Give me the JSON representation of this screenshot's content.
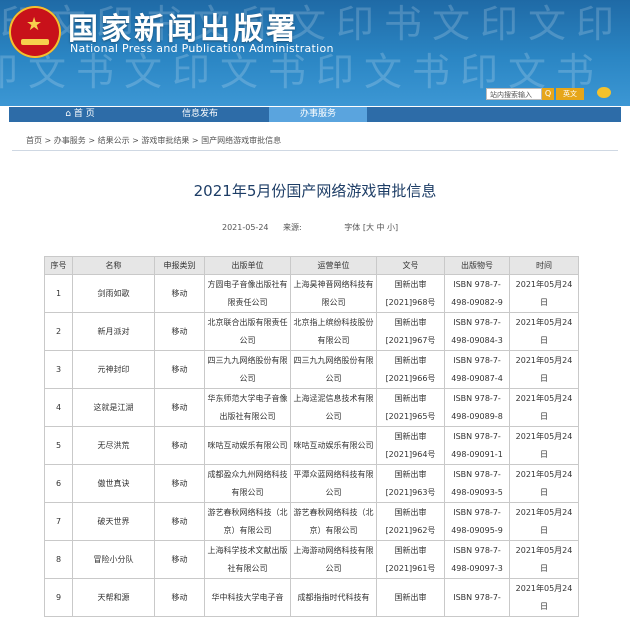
{
  "site": {
    "title": "国家新闻出版署",
    "subtitle": "National Press and Publication Administration",
    "search_placeholder": "站内搜索输入",
    "search_button": "Q",
    "lang_label": "英文"
  },
  "nav": [
    {
      "label": "首  页",
      "active": false
    },
    {
      "label": "信息发布",
      "active": false
    },
    {
      "label": "办事服务",
      "active": true
    }
  ],
  "breadcrumb": "首页 > 办事服务 > 结果公示 > 游戏审批结果 > 国产网络游戏审批信息",
  "article": {
    "title": "2021年5月份国产网络游戏审批信息",
    "date": "2021-05-24",
    "source_label": "来源:",
    "font_label": "字体 [大 中 小]"
  },
  "table": {
    "headers": [
      "序号",
      "名称",
      "申报类别",
      "出版单位",
      "运营单位",
      "文号",
      "出版物号",
      "时间"
    ],
    "rows": [
      [
        "1",
        "剑雨如歌",
        "移动",
        "方圆电子音像出版社有限责任公司",
        "上海昊神晋网络科技有限公司",
        "国新出审[2021]968号",
        "ISBN 978-7-498-09082-9",
        "2021年05月24日"
      ],
      [
        "2",
        "新月派对",
        "移动",
        "北京联合出版有限责任公司",
        "北京指上缤纷科技股份有限公司",
        "国新出审[2021]967号",
        "ISBN 978-7-498-09084-3",
        "2021年05月24日"
      ],
      [
        "3",
        "元神封印",
        "移动",
        "四三九九网络股份有限公司",
        "四三九九网络股份有限公司",
        "国新出审[2021]966号",
        "ISBN 978-7-498-09087-4",
        "2021年05月24日"
      ],
      [
        "4",
        "这就是江湖",
        "移动",
        "华东师范大学电子音像出版社有限公司",
        "上海迳泥信息技术有限公司",
        "国新出审[2021]965号",
        "ISBN 978-7-498-09089-8",
        "2021年05月24日"
      ],
      [
        "5",
        "无尽洪荒",
        "移动",
        "咪咕互动娱乐有限公司",
        "咪咕互动娱乐有限公司",
        "国新出审[2021]964号",
        "ISBN 978-7-498-09091-1",
        "2021年05月24日"
      ],
      [
        "6",
        "傲世真诀",
        "移动",
        "成都盈众九州网络科技有限公司",
        "平潭众蓝网络科技有限公司",
        "国新出审[2021]963号",
        "ISBN 978-7-498-09093-5",
        "2021年05月24日"
      ],
      [
        "7",
        "破天世界",
        "移动",
        "游艺春秋网络科技（北京）有限公司",
        "游艺春秋网络科技（北京）有限公司",
        "国新出审[2021]962号",
        "ISBN 978-7-498-09095-9",
        "2021年05月24日"
      ],
      [
        "8",
        "冒险小分队",
        "移动",
        "上海科学技术文献出版社有限公司",
        "上海游动网络科技有限公司",
        "国新出审[2021]961号",
        "ISBN 978-7-498-09097-3",
        "2021年05月24日"
      ],
      [
        "9",
        "天帮和源",
        "移动",
        "华中科技大学电子音",
        "成都指指时代科技有",
        "国新出审",
        "ISBN 978-7-",
        "2021年05月24日"
      ]
    ]
  }
}
